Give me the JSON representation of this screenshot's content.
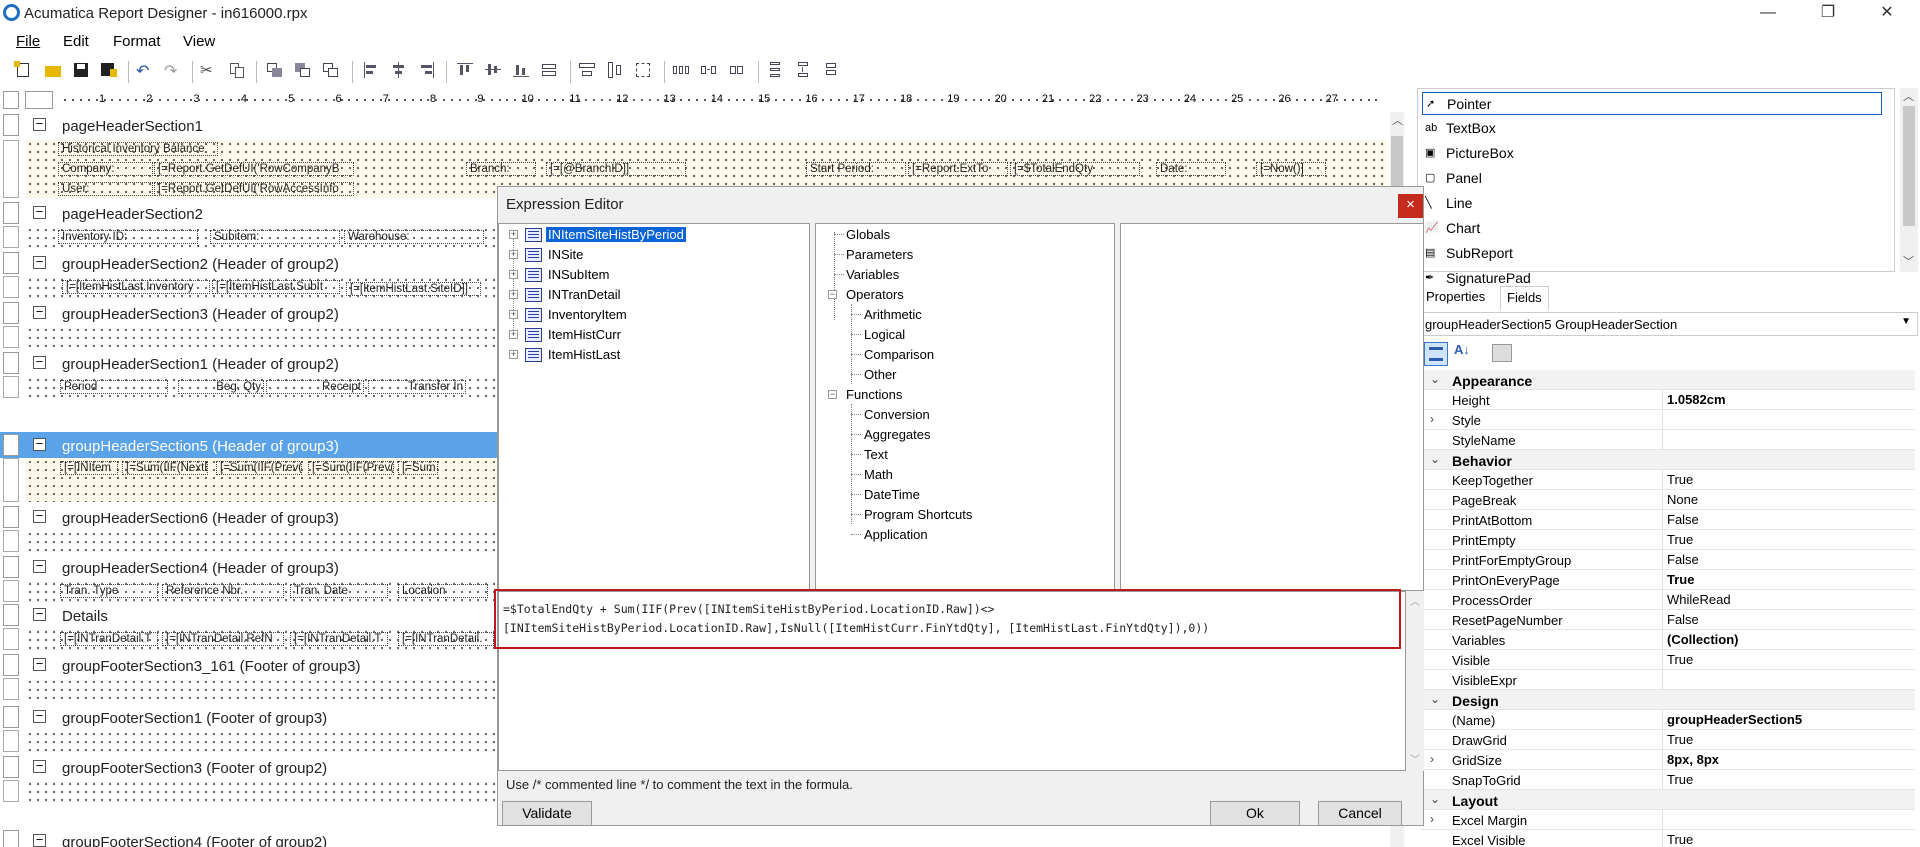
{
  "window": {
    "title": "Acumatica Report Designer - in616000.rpx",
    "minimize": "—",
    "restore": "❐",
    "close": "✕"
  },
  "menu": [
    "File",
    "Edit",
    "Format",
    "View"
  ],
  "ruler": [
    "1",
    "2",
    "3",
    "4",
    "5",
    "6",
    "7",
    "8",
    "9",
    "10",
    "11",
    "12",
    "13",
    "14",
    "15",
    "16",
    "17",
    "18",
    "19",
    "20",
    "21",
    "22",
    "23",
    "24",
    "25",
    "26",
    "27"
  ],
  "sections": {
    "pageHeaderSection1": "pageHeaderSection1",
    "pageHeaderSection2": "pageHeaderSection2",
    "groupHeaderSection2": "groupHeaderSection2 (Header of group2)",
    "groupHeaderSection3": "groupHeaderSection3 (Header of group2)",
    "groupHeaderSection1": "groupHeaderSection1 (Header of group2)",
    "groupHeaderSection5": "groupHeaderSection5 (Header of group3)",
    "groupHeaderSection6": "groupHeaderSection6 (Header of group3)",
    "groupHeaderSection4": "groupHeaderSection4 (Header of group3)",
    "details": "Details",
    "groupFooterSection3_161": "groupFooterSection3_161 (Footer of group3)",
    "groupFooterSection1": "groupFooterSection1 (Footer of group3)",
    "groupFooterSection3": "groupFooterSection3 (Footer of group2)",
    "groupFooterSection4": "groupFooterSection4 (Footer of group2)"
  },
  "fields": {
    "ph1": [
      "Historical Inventory Balance",
      "Company:",
      "[=Report.GetDefUI('RowCompanyB",
      "Branch:",
      "[=[@BranchID]]",
      "Start Period:",
      "[=Report.ExtTo",
      "[=$TotalEndQty",
      "Date:",
      "[=Now()]",
      "User:",
      "[=Report.GetDefUI('RowAccessInfo"
    ],
    "ph2": [
      "Inventory ID:",
      "Subitem:",
      "Warehouse:"
    ],
    "gh2": [
      "[=[ItemHistLast.Inventory",
      "[=[ItemHistLast.SubIt",
      "[=[ItemHistLast.SiteID]]"
    ],
    "gh1": [
      "Period",
      "Beg. Qty",
      "Receipt",
      "Transfer In"
    ],
    "gh5": [
      "[=[INItem",
      "[=Sum(IIF(NextExi",
      "[=Sum(IIF(Prev([I",
      "[=Sum(IIF(Prev([I",
      "[=Sum"
    ],
    "gh4": [
      "Tran. Type",
      "Reference Nbr.",
      "Tran. Date",
      "Location"
    ],
    "det": [
      "[=[INTranDetail.T",
      "[=[INTranDetail.RefN",
      "[=[INTranDetail.T",
      "[=[INTranDetail."
    ]
  },
  "toolbox": {
    "items": [
      "Pointer",
      "TextBox",
      "PictureBox",
      "Panel",
      "Line",
      "Chart",
      "SubReport",
      "SignaturePad"
    ],
    "icons": [
      "pointer-icon",
      "textbox-icon",
      "picturebox-icon",
      "panel-icon",
      "line-icon",
      "chart-icon",
      "subreport-icon",
      "signature-icon"
    ]
  },
  "properties": {
    "tabs": [
      "Properties",
      "Fields"
    ],
    "object": "groupHeaderSection5 GroupHeaderSection",
    "rows": [
      {
        "cat": true,
        "name": "Appearance"
      },
      {
        "name": "Height",
        "value": "1.0582cm",
        "bold": true
      },
      {
        "name": "Style",
        "value": "",
        "expand": true
      },
      {
        "name": "StyleName",
        "value": ""
      },
      {
        "cat": true,
        "name": "Behavior"
      },
      {
        "name": "KeepTogether",
        "value": "True"
      },
      {
        "name": "PageBreak",
        "value": "None"
      },
      {
        "name": "PrintAtBottom",
        "value": "False"
      },
      {
        "name": "PrintEmpty",
        "value": "True"
      },
      {
        "name": "PrintForEmptyGroup",
        "value": "False"
      },
      {
        "name": "PrintOnEveryPage",
        "value": "True",
        "bold": true
      },
      {
        "name": "ProcessOrder",
        "value": "WhileRead"
      },
      {
        "name": "ResetPageNumber",
        "value": "False"
      },
      {
        "name": "Variables",
        "value": "(Collection)",
        "bold": true
      },
      {
        "name": "Visible",
        "value": "True"
      },
      {
        "name": "VisibleExpr",
        "value": ""
      },
      {
        "cat": true,
        "name": "Design"
      },
      {
        "name": "(Name)",
        "value": "groupHeaderSection5",
        "bold": true
      },
      {
        "name": "DrawGrid",
        "value": "True"
      },
      {
        "name": "GridSize",
        "value": "8px, 8px",
        "bold": true,
        "expand": true
      },
      {
        "name": "SnapToGrid",
        "value": "True"
      },
      {
        "cat": true,
        "name": "Layout"
      },
      {
        "name": "Excel Margin",
        "value": "",
        "expand": true
      },
      {
        "name": "Excel Visible",
        "value": "True"
      }
    ]
  },
  "dialog": {
    "title": "Expression Editor",
    "close": "×",
    "tables": [
      "INItemSiteHistByPeriod",
      "INSite",
      "INSubItem",
      "INTranDetail",
      "InventoryItem",
      "ItemHistCurr",
      "ItemHistLast"
    ],
    "middle": {
      "globals": "Globals",
      "parameters": "Parameters",
      "variables": "Variables",
      "operators": "Operators",
      "op_items": [
        "Arithmetic",
        "Logical",
        "Comparison",
        "Other"
      ],
      "functions": "Functions",
      "fn_items": [
        "Conversion",
        "Aggregates",
        "Text",
        "Math",
        "DateTime",
        "Program Shortcuts",
        "Application"
      ]
    },
    "expression_line1": "=$TotalEndQty + Sum(IIF(Prev([INItemSiteHistByPeriod.LocationID.Raw])<>",
    "expression_line2": "[INItemSiteHistByPeriod.LocationID.Raw],IsNull([ItemHistCurr.FinYtdQty], [ItemHistLast.FinYtdQty]),0))",
    "hint": "Use /* commented line */ to comment the text in the formula.",
    "validate": "Validate",
    "ok": "Ok",
    "cancel": "Cancel"
  }
}
